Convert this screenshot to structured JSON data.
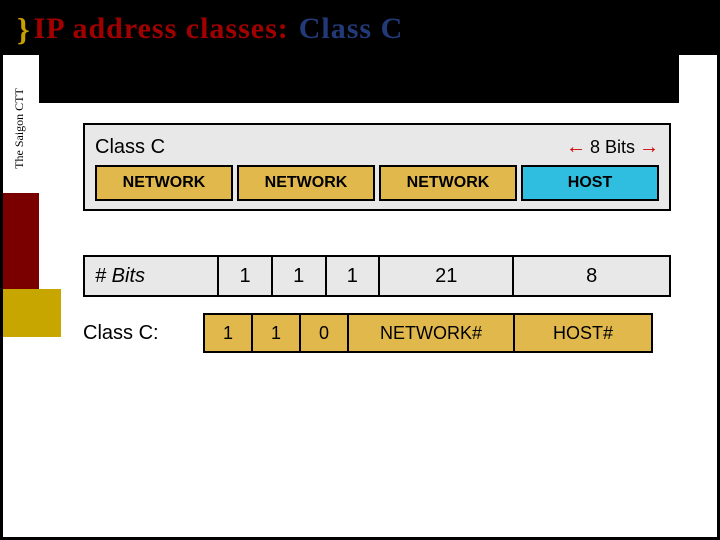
{
  "header": {
    "brace": "}",
    "title_part1": "IP address classes:",
    "title_part2": "Class C"
  },
  "sidebar": {
    "org": "The Saigon CTT"
  },
  "diagram": {
    "class_label": "Class C",
    "bits_span": "8 Bits",
    "octets": [
      {
        "label": "NETWORK",
        "kind": "net"
      },
      {
        "label": "NETWORK",
        "kind": "net"
      },
      {
        "label": "NETWORK",
        "kind": "net"
      },
      {
        "label": "HOST",
        "kind": "host"
      }
    ],
    "bits_header": "# Bits",
    "bits": [
      "1",
      "1",
      "1",
      "21",
      "8"
    ],
    "row_label": "Class C:",
    "fields": [
      "1",
      "1",
      "0",
      "NETWORK#",
      "HOST#"
    ]
  }
}
